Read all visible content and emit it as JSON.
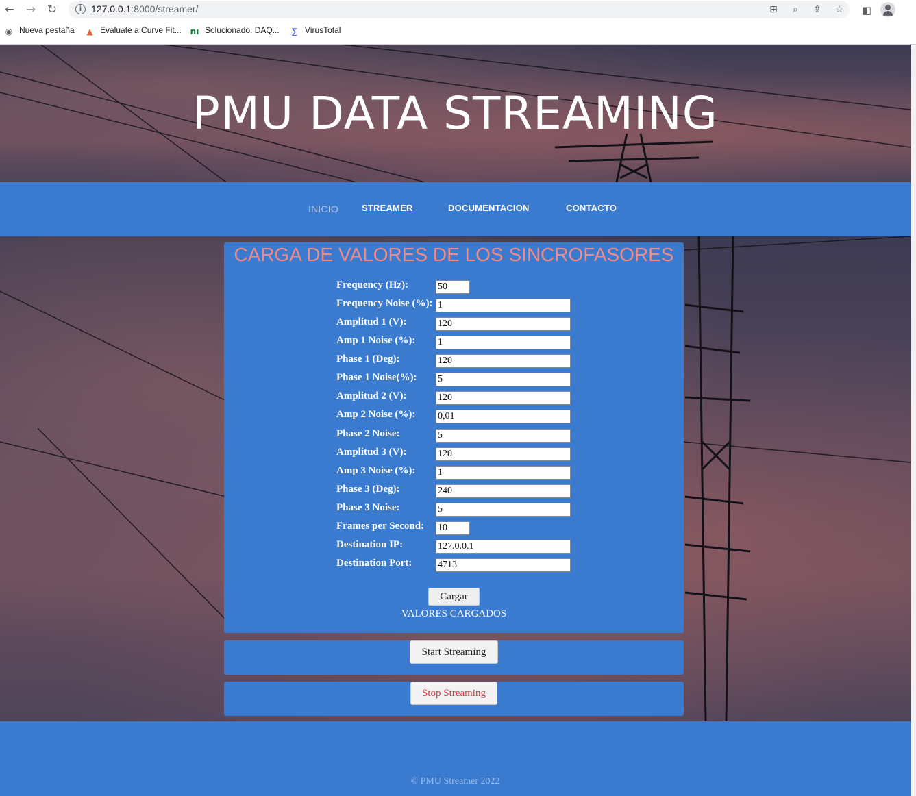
{
  "browser": {
    "nav": {
      "back": "←",
      "forward": "→",
      "reload": "↻"
    },
    "url_host": "127.0.0.1",
    "url_path": ":8000/streamer/",
    "bookmarks": [
      {
        "label": "Nueva pestaña",
        "icon": "globe-icon"
      },
      {
        "label": "Evaluate a Curve Fit...",
        "icon": "matlab-icon"
      },
      {
        "label": "Solucionado: DAQ...",
        "icon": "ni-icon"
      },
      {
        "label": "VirusTotal",
        "icon": "virustotal-icon"
      }
    ]
  },
  "hero": {
    "title": "PMU DATA STREAMING"
  },
  "nav": {
    "items": [
      {
        "label": "INICIO"
      },
      {
        "label": "STREAMER"
      },
      {
        "label": "DOCUMENTACION"
      },
      {
        "label": "CONTACTO"
      }
    ]
  },
  "form": {
    "title": "CARGA DE VALORES DE LOS SINCROFASORES",
    "fields": [
      {
        "label": "Frequency (Hz):",
        "value": "50"
      },
      {
        "label": "Frequency Noise (%):",
        "value": "1"
      },
      {
        "label": "Amplitud 1 (V):",
        "value": "120"
      },
      {
        "label": "Amp 1 Noise (%):",
        "value": "1"
      },
      {
        "label": "Phase 1 (Deg):",
        "value": "120"
      },
      {
        "label": "Phase 1 Noise(%):",
        "value": "5"
      },
      {
        "label": "Amplitud 2 (V):",
        "value": "120"
      },
      {
        "label": "Amp 2 Noise (%):",
        "value": "0,01"
      },
      {
        "label": "Phase 2 Noise:",
        "value": "5"
      },
      {
        "label": "Amplitud 3 (V):",
        "value": "120"
      },
      {
        "label": "Amp 3 Noise (%):",
        "value": "1"
      },
      {
        "label": "Phase 3 (Deg):",
        "value": "240"
      },
      {
        "label": "Phase 3 Noise:",
        "value": "5"
      },
      {
        "label": "Frames per Second:",
        "value": "10"
      },
      {
        "label": "Destination IP:",
        "value": "127.0.0.1"
      },
      {
        "label": "Destination Port:",
        "value": "4713"
      }
    ],
    "submit_label": "Cargar",
    "status": "VALORES CARGADOS"
  },
  "controls": {
    "start_label": "Start Streaming",
    "stop_label": "Stop Streaming"
  },
  "footer": {
    "text": "© PMU Streamer 2022"
  },
  "colors": {
    "accent": "#3a7bd0",
    "title_pink": "#f08a87",
    "stop_red": "#dc3545"
  }
}
